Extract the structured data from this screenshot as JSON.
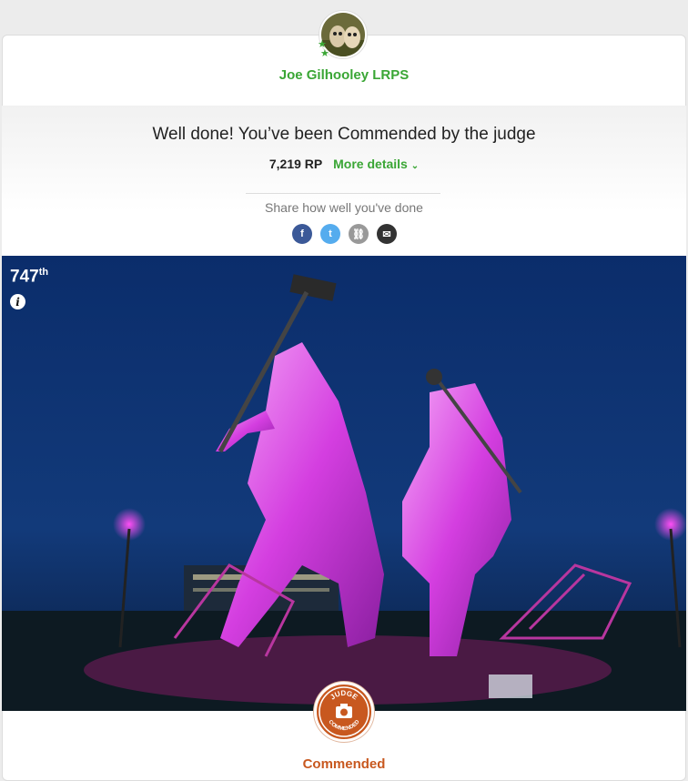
{
  "entry": {
    "username": "Joe Gilhooley LRPS",
    "headline": "Well done! You’ve been Commended by the judge",
    "points": "7,219 RP",
    "more_details": "More details",
    "share_label": "Share how well you've done",
    "rank_number": "747",
    "rank_suffix": "th",
    "award_label": "Commended",
    "badge_top": "JUDGE",
    "badge_bottom": "COMMENDED"
  },
  "share_buttons": [
    {
      "icon": "facebook-icon",
      "glyph": "f"
    },
    {
      "icon": "twitter-icon",
      "glyph": "t"
    },
    {
      "icon": "link-icon",
      "glyph": "⛓"
    },
    {
      "icon": "email-icon",
      "glyph": "✉"
    }
  ],
  "colors": {
    "accent_green": "#3aa635",
    "award_orange": "#c8581f",
    "photo_sky": "#0c2f6e",
    "statue_magenta": "#d43ee0"
  }
}
